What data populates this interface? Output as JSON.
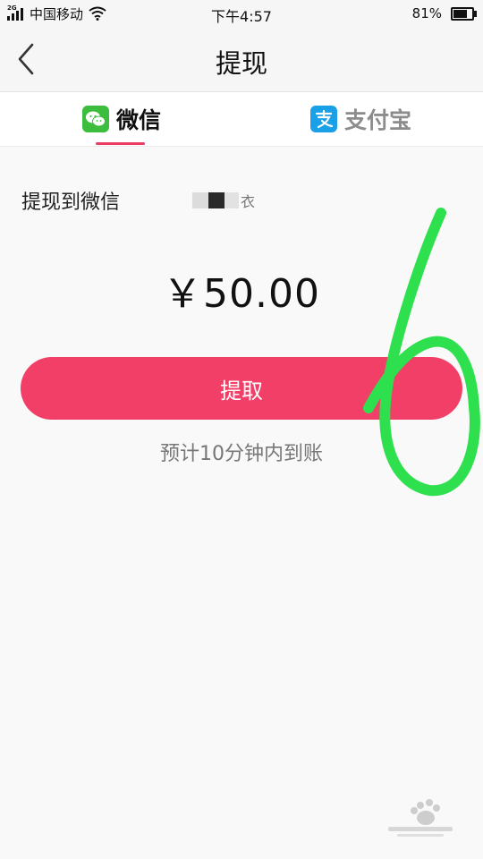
{
  "status_bar": {
    "network": "2G",
    "carrier": "中国移动",
    "time": "下午4:57",
    "battery_percent": "81%",
    "battery_level": 0.81
  },
  "nav": {
    "title": "提现"
  },
  "tabs": [
    {
      "label": "微信",
      "icon": "wechat-icon",
      "selected": true
    },
    {
      "label": "支付宝",
      "icon": "alipay-icon",
      "selected": false
    }
  ],
  "withdraw": {
    "target_label": "提现到微信",
    "account_tail": "衣",
    "amount": "￥50.00",
    "button_label": "提取",
    "eta_text": "预计10分钟内到账"
  },
  "annotation": {
    "handwritten_mark": "6",
    "color": "#2fe04e"
  },
  "colors": {
    "accent": "#f13f68",
    "wechat": "#3dbd3d",
    "alipay": "#1aa0e6"
  }
}
